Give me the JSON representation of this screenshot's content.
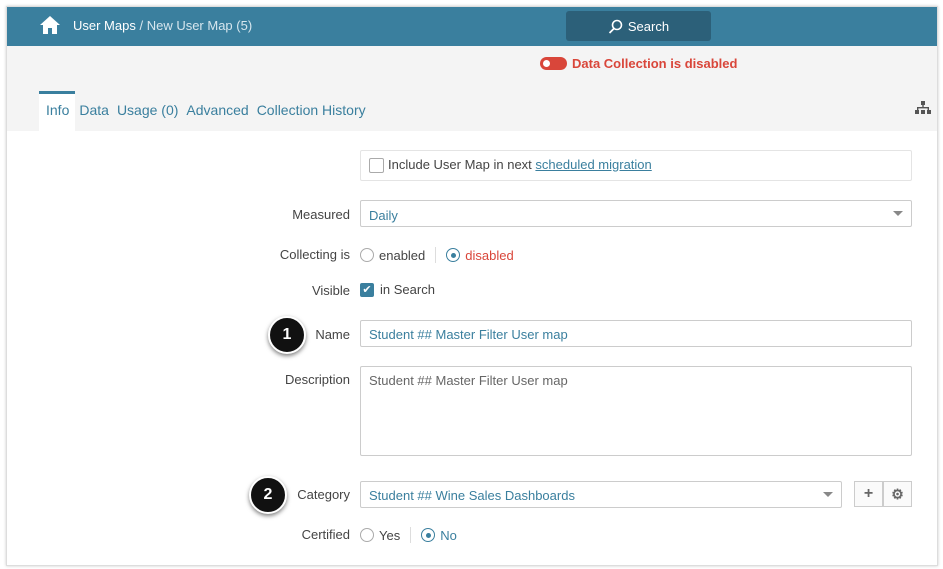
{
  "header": {
    "breadcrumb_root": "User Maps",
    "breadcrumb_current": " / New User Map (5)",
    "search_label": "Search"
  },
  "status": {
    "data_collection": "Data Collection is disabled"
  },
  "tabs": [
    {
      "label": "Info"
    },
    {
      "label": "Data"
    },
    {
      "label": "Usage (0)"
    },
    {
      "label": "Advanced"
    },
    {
      "label": "Collection History"
    }
  ],
  "form": {
    "migration_text": "Include User Map in next ",
    "migration_link": "scheduled migration",
    "measured_label": "Measured",
    "measured_value": "Daily",
    "collecting_label": "Collecting is",
    "collecting_enabled": "enabled",
    "collecting_disabled": "disabled",
    "visible_label": "Visible",
    "visible_option": "in Search",
    "name_label": "Name",
    "name_value": "Student ## Master Filter User map",
    "description_label": "Description",
    "description_value": "Student ## Master Filter User map",
    "category_label": "Category",
    "category_value": "Student ## Wine Sales Dashboards",
    "certified_label": "Certified",
    "certified_yes": "Yes",
    "certified_no": "No"
  },
  "annotations": [
    "1",
    "2"
  ],
  "colors": {
    "header": "#3a7f9e",
    "alert": "#d9463a"
  }
}
